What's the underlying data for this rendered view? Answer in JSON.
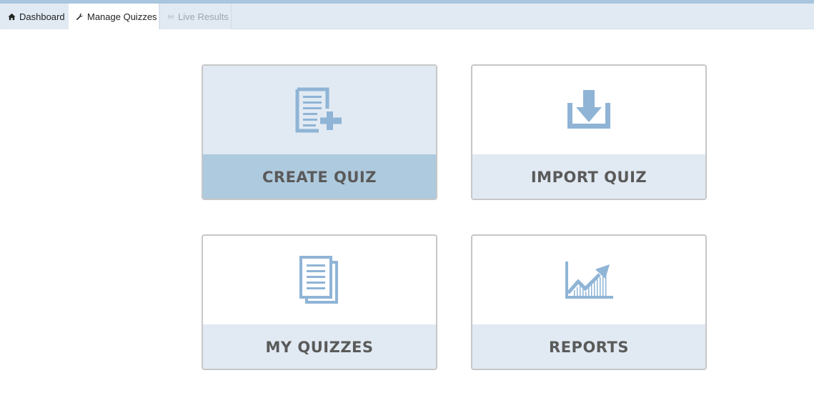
{
  "tabs": [
    {
      "label": "Dashboard",
      "icon": "home-icon"
    },
    {
      "label": "Manage Quizzes",
      "icon": "wrench-icon"
    },
    {
      "label": "Live Results",
      "icon": "broadcast-icon"
    }
  ],
  "cards": [
    {
      "label": "CREATE QUIZ",
      "icon": "document-plus-icon"
    },
    {
      "label": "IMPORT QUIZ",
      "icon": "import-tray-icon"
    },
    {
      "label": "MY QUIZZES",
      "icon": "documents-stack-icon"
    },
    {
      "label": "REPORTS",
      "icon": "chart-trend-icon"
    }
  ],
  "colors": {
    "top_strip": "#a9c6df",
    "tabbar_bg": "#e1eaf3",
    "card_label_bg": "#e1eaf3",
    "card_active_label_bg": "#aecade",
    "icon_blue": "#8fb4d6",
    "label_text": "#5a5a5a"
  }
}
